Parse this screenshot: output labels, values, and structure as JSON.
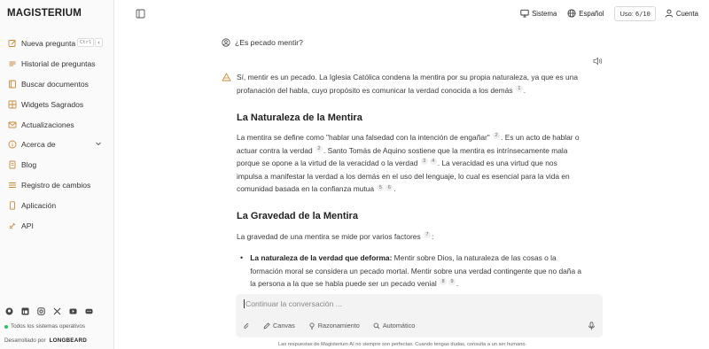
{
  "app": {
    "logo": "MAGISTERIUM"
  },
  "sidebar": {
    "items": [
      {
        "label": "Nueva pregunta",
        "icon": "edit-icon",
        "shortcut": "Ctrl"
      },
      {
        "label": "Historial de preguntas",
        "icon": "history-icon"
      },
      {
        "label": "Buscar documentos",
        "icon": "book-icon"
      },
      {
        "label": "Widgets Sagrados",
        "icon": "grid-icon"
      },
      {
        "label": "Actualizaciones",
        "icon": "mail-icon"
      },
      {
        "label": "Acerca de",
        "icon": "info-icon"
      },
      {
        "label": "Blog",
        "icon": "file-icon"
      },
      {
        "label": "Registro de cambios",
        "icon": "list-icon"
      },
      {
        "label": "Aplicación",
        "icon": "phone-icon"
      },
      {
        "label": "API",
        "icon": "api-icon"
      }
    ],
    "social": [
      "github-icon",
      "linkedin-icon",
      "instagram-icon",
      "x-icon",
      "youtube-icon",
      "discord-icon"
    ],
    "status_text": "Todos los sistemas operativos",
    "developer_prefix": "Desarrollado por",
    "developer_name": "LONGBEARD"
  },
  "topbar": {
    "theme": "Sistema",
    "language": "Español",
    "usage_label": "Uso:",
    "usage_value": "6/10",
    "account": "Cuenta"
  },
  "conversation": {
    "question": "¿Es pecado mentir?",
    "intro_text": "Sí, mentir es un pecado. La Iglesia Católica condena la mentira por su propia naturaleza, ya que es una profanación del habla, cuyo propósito es comunicar la verdad conocida a los demás",
    "intro_refs": [
      "1"
    ],
    "section1_title": "La Naturaleza de la Mentira",
    "section1_p_a": "La mentira se define como \"hablar una falsedad con la intención de engañar\"",
    "section1_p_b": ". Es un acto de hablar o actuar contra la verdad",
    "section1_p_c": ". Santo Tomás de Aquino sostiene que la mentira es intrínsecamente mala porque se opone a la virtud de la veracidad o la verdad",
    "section1_p_d": ". La veracidad es una virtud que nos impulsa a manifestar la verdad a los demás en el uso del lenguaje, lo cual es esencial para la vida en comunidad basada en la confianza mutua",
    "section1_refs": [
      "2",
      "2",
      "3",
      "4",
      "5",
      "6"
    ],
    "section2_title": "La Gravedad de la Mentira",
    "section2_p": "La gravedad de una mentira se mide por varios factores",
    "section2_refs": [
      "7"
    ],
    "bullet1_bold": "La naturaleza de la verdad que deforma:",
    "bullet1_text": " Mentir sobre Dios, la naturaleza de las cosas o la formación moral se considera un pecado mortal. Mentir sobre una verdad contingente que no daña a la persona a la que se habla puede ser un pecado venial",
    "bullet1_refs": [
      "8",
      "9"
    ]
  },
  "composer": {
    "placeholder": "Continuar la conversación ...",
    "tools": [
      "Canvas",
      "Razonamiento",
      "Automático"
    ]
  },
  "disclaimer": "Las respuestas de Magisterium AI no siempre son perfectas. Cuando tengas dudas, consulta a un ser humano."
}
